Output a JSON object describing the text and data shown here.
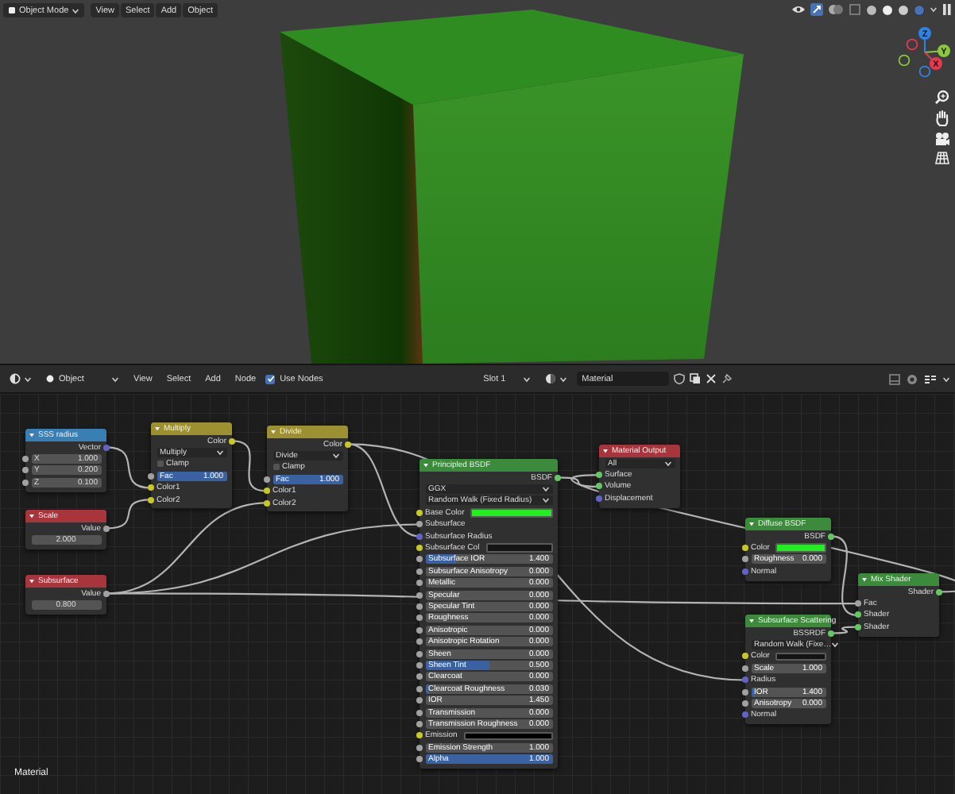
{
  "viewport": {
    "header": {
      "mode": "Object Mode",
      "menus": [
        "View",
        "Select",
        "Add",
        "Object"
      ]
    },
    "gizmo": [
      {
        "axis": "Z",
        "color": "#2f83e3"
      },
      {
        "axis": "Y",
        "color": "#8bc63d"
      },
      {
        "axis": "X",
        "color": "#e8384f"
      }
    ]
  },
  "node_editor": {
    "header": {
      "editor": "Object",
      "menus": [
        "View",
        "Select",
        "Add",
        "Node"
      ],
      "use_nodes": {
        "label": "Use Nodes",
        "checked": true
      },
      "slot": "Slot 1",
      "material": "Material"
    },
    "nodes": [
      {
        "title": "SSS radius",
        "color": "#3a7fb4",
        "rows": [
          {
            "kind": "output",
            "label": "Vector",
            "socket": {
              "color": "#6363c7"
            }
          },
          {
            "kind": "number",
            "label": "X",
            "value": "1.000",
            "socket": {
              "color": "#a1a1a1"
            }
          },
          {
            "kind": "number",
            "label": "Y",
            "value": "0.200",
            "socket": {
              "color": "#a1a1a1"
            }
          },
          {
            "kind": "number",
            "label": "Z",
            "value": "0.100",
            "socket": {
              "color": "#a1a1a1"
            }
          }
        ]
      },
      {
        "title": "Multiply",
        "color": "#9c9030",
        "rows": [
          {
            "kind": "output",
            "label": "Color",
            "socket": {
              "color": "#c7c729"
            }
          },
          {
            "kind": "dropdown",
            "value": "Multiply"
          },
          {
            "kind": "checkbox",
            "label": "Clamp",
            "checked": false
          },
          {
            "kind": "slider",
            "label": "Fac",
            "value": "1.000",
            "level": 1,
            "socket": {
              "color": "#a1a1a1"
            }
          },
          {
            "kind": "input",
            "label": "Color1",
            "socket": {
              "color": "#c7c729"
            }
          },
          {
            "kind": "input",
            "label": "Color2",
            "socket": {
              "color": "#c7c729"
            }
          }
        ]
      },
      {
        "title": "Divide",
        "color": "#9c9030",
        "rows": [
          {
            "kind": "output",
            "label": "Color",
            "socket": {
              "color": "#c7c729"
            }
          },
          {
            "kind": "dropdown",
            "value": "Divide"
          },
          {
            "kind": "checkbox",
            "label": "Clamp",
            "checked": false
          },
          {
            "kind": "slider",
            "label": "Fac",
            "value": "1.000",
            "level": 1,
            "socket": {
              "color": "#a1a1a1"
            }
          },
          {
            "kind": "input",
            "label": "Color1",
            "socket": {
              "color": "#c7c729"
            }
          },
          {
            "kind": "input",
            "label": "Color2",
            "socket": {
              "color": "#c7c729"
            }
          }
        ]
      },
      {
        "title": "Scale",
        "color": "#a8343c",
        "rows": [
          {
            "kind": "output",
            "label": "Value",
            "socket": {
              "color": "#a1a1a1"
            }
          },
          {
            "kind": "number",
            "value": "2.000"
          }
        ]
      },
      {
        "title": "Subsurface",
        "color": "#a8343c",
        "rows": [
          {
            "kind": "output",
            "label": "Value",
            "socket": {
              "color": "#a1a1a1"
            }
          },
          {
            "kind": "number",
            "value": "0.800"
          }
        ]
      },
      {
        "title": "Principled BSDF",
        "color": "#3c8a3c",
        "rows": [
          {
            "kind": "output",
            "label": "BSDF",
            "socket": {
              "color": "#63c763"
            }
          },
          {
            "kind": "dropdown",
            "value": "GGX"
          },
          {
            "kind": "dropdown",
            "value": "Random Walk (Fixed Radius)"
          },
          {
            "kind": "color",
            "label": "Base Color",
            "color": "#22ee22",
            "socket": {
              "color": "#c7c729"
            }
          },
          {
            "kind": "input",
            "label": "Subsurface",
            "socket": {
              "color": "#a1a1a1"
            }
          },
          {
            "kind": "input",
            "label": "Subsurface Radius",
            "socket": {
              "color": "#6363c7"
            }
          },
          {
            "kind": "color",
            "label": "Subsurface Col",
            "color": "#141414",
            "socket": {
              "color": "#c7c729"
            }
          },
          {
            "kind": "slider",
            "label": "Subsurface IOR",
            "value": "1.400",
            "level": 0.24,
            "socket": {
              "color": "#a1a1a1"
            }
          },
          {
            "kind": "slider",
            "label": "Subsurface Anisotropy",
            "value": "0.000",
            "level": 0,
            "socket": {
              "color": "#a1a1a1"
            }
          },
          {
            "kind": "slider",
            "label": "Metallic",
            "value": "0.000",
            "level": 0,
            "socket": {
              "color": "#a1a1a1"
            }
          },
          {
            "kind": "slider",
            "label": "Specular",
            "value": "0.000",
            "level": 0,
            "socket": {
              "color": "#a1a1a1"
            }
          },
          {
            "kind": "slider",
            "label": "Specular Tint",
            "value": "0.000",
            "level": 0,
            "socket": {
              "color": "#a1a1a1"
            }
          },
          {
            "kind": "slider",
            "label": "Roughness",
            "value": "0.000",
            "level": 0,
            "socket": {
              "color": "#a1a1a1"
            }
          },
          {
            "kind": "slider",
            "label": "Anisotropic",
            "value": "0.000",
            "level": 0,
            "socket": {
              "color": "#a1a1a1"
            }
          },
          {
            "kind": "slider",
            "label": "Anisotropic Rotation",
            "value": "0.000",
            "level": 0,
            "socket": {
              "color": "#a1a1a1"
            }
          },
          {
            "kind": "slider",
            "label": "Sheen",
            "value": "0.000",
            "level": 0,
            "socket": {
              "color": "#a1a1a1"
            }
          },
          {
            "kind": "slider",
            "label": "Sheen Tint",
            "value": "0.500",
            "level": 0.5,
            "socket": {
              "color": "#a1a1a1"
            }
          },
          {
            "kind": "slider",
            "label": "Clearcoat",
            "value": "0.000",
            "level": 0,
            "socket": {
              "color": "#a1a1a1"
            }
          },
          {
            "kind": "slider",
            "label": "Clearcoat Roughness",
            "value": "0.030",
            "level": 0.03,
            "socket": {
              "color": "#a1a1a1"
            }
          },
          {
            "kind": "slider",
            "label": "IOR",
            "value": "1.450",
            "level": 0,
            "socket": {
              "color": "#a1a1a1"
            }
          },
          {
            "kind": "slider",
            "label": "Transmission",
            "value": "0.000",
            "level": 0,
            "socket": {
              "color": "#a1a1a1"
            }
          },
          {
            "kind": "slider",
            "label": "Transmission Roughness",
            "value": "0.000",
            "level": 0,
            "socket": {
              "color": "#a1a1a1"
            }
          },
          {
            "kind": "color",
            "label": "Emission",
            "color": "#000000",
            "socket": {
              "color": "#c7c729"
            }
          },
          {
            "kind": "slider",
            "label": "Emission Strength",
            "value": "1.000",
            "level": 0,
            "socket": {
              "color": "#a1a1a1"
            }
          },
          {
            "kind": "slider",
            "label": "Alpha",
            "value": "1.000",
            "level": 1,
            "socket": {
              "color": "#a1a1a1"
            }
          }
        ]
      },
      {
        "title": "Material Output",
        "color": "#a8343c",
        "rows": [
          {
            "kind": "dropdown",
            "value": "All"
          },
          {
            "kind": "input",
            "label": "Surface",
            "socket": {
              "color": "#63c763"
            }
          },
          {
            "kind": "input",
            "label": "Volume",
            "socket": {
              "color": "#63c763"
            }
          },
          {
            "kind": "input",
            "label": "Displacement",
            "socket": {
              "color": "#6363c7"
            }
          }
        ]
      },
      {
        "title": "Diffuse BSDF",
        "color": "#3c8a3c",
        "rows": [
          {
            "kind": "output",
            "label": "BSDF",
            "socket": {
              "color": "#63c763"
            }
          },
          {
            "kind": "color",
            "label": "Color",
            "color": "#22ee22",
            "socket": {
              "color": "#c7c729"
            }
          },
          {
            "kind": "slider",
            "label": "Roughness",
            "value": "0.000",
            "level": 0,
            "socket": {
              "color": "#a1a1a1"
            }
          },
          {
            "kind": "input",
            "label": "Normal",
            "socket": {
              "color": "#6363c7"
            }
          }
        ]
      },
      {
        "title": "Mix Shader",
        "color": "#3c8a3c",
        "rows": [
          {
            "kind": "output",
            "label": "Shader",
            "socket": {
              "color": "#63c763"
            }
          },
          {
            "kind": "input",
            "label": "Fac",
            "socket": {
              "color": "#a1a1a1"
            }
          },
          {
            "kind": "input",
            "label": "Shader",
            "socket": {
              "color": "#63c763"
            }
          },
          {
            "kind": "input",
            "label": "Shader",
            "socket": {
              "color": "#63c763"
            }
          }
        ]
      },
      {
        "title": "Subsurface Scattering",
        "color": "#3c8a3c",
        "rows": [
          {
            "kind": "output",
            "label": "BSSRDF",
            "socket": {
              "color": "#63c763"
            }
          },
          {
            "kind": "dropdown",
            "value": "Random Walk (Fixe…"
          },
          {
            "kind": "color",
            "label": "Color",
            "color": "#141414",
            "socket": {
              "color": "#c7c729"
            }
          },
          {
            "kind": "slider",
            "label": "Scale",
            "value": "1.000",
            "level": 0,
            "socket": {
              "color": "#a1a1a1"
            }
          },
          {
            "kind": "input",
            "label": "Radius",
            "socket": {
              "color": "#6363c7"
            }
          },
          {
            "kind": "slider",
            "label": "IOR",
            "value": "1.400",
            "level": 0.06,
            "socket": {
              "color": "#a1a1a1"
            }
          },
          {
            "kind": "slider",
            "label": "Anisotropy",
            "value": "0.000",
            "level": 0,
            "socket": {
              "color": "#a1a1a1"
            }
          },
          {
            "kind": "input",
            "label": "Normal",
            "socket": {
              "color": "#6363c7"
            }
          }
        ]
      }
    ],
    "footer_label": "Material"
  }
}
